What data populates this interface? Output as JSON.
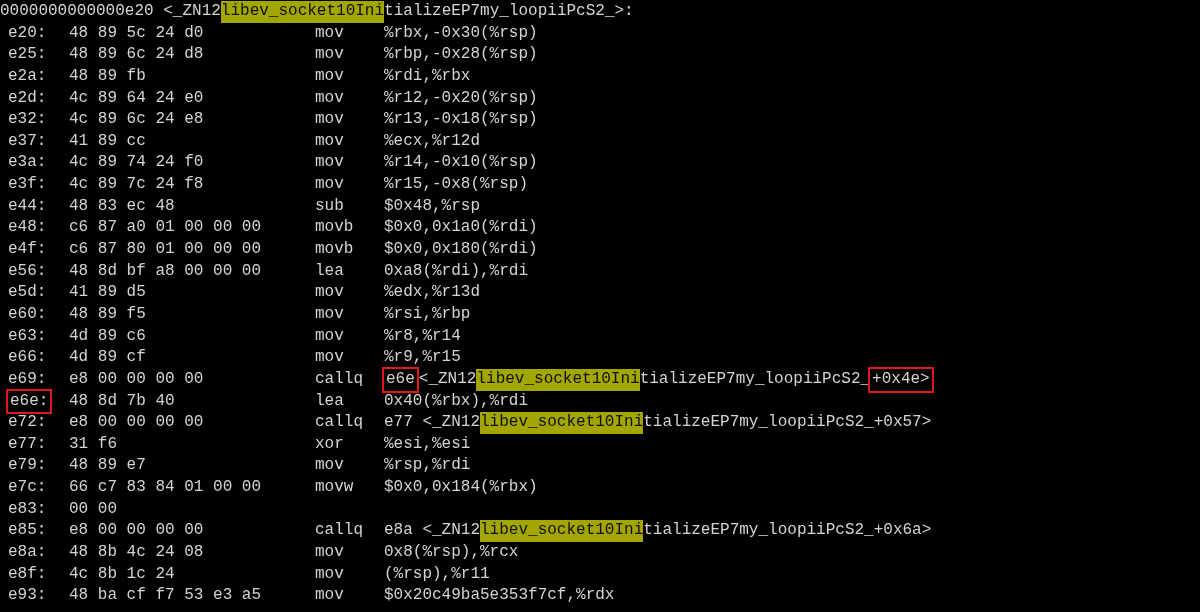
{
  "header": [
    {
      "text": "0000000000000e20 <_ZN12",
      "kind": "plain"
    },
    {
      "text": "libev_socket10Ini",
      "kind": "match"
    },
    {
      "text": "tializeEP7my_loopiiPcS2_>:",
      "kind": "plain"
    }
  ],
  "rows": [
    {
      "address": "e20:",
      "boxed": false,
      "bytes": "48 89 5c 24 d0",
      "mnemonic": "mov",
      "operand": [
        {
          "text": "%rbx,-0x30(%rsp)",
          "kind": "plain"
        }
      ]
    },
    {
      "address": "e25:",
      "boxed": false,
      "bytes": "48 89 6c 24 d8",
      "mnemonic": "mov",
      "operand": [
        {
          "text": "%rbp,-0x28(%rsp)",
          "kind": "plain"
        }
      ]
    },
    {
      "address": "e2a:",
      "boxed": false,
      "bytes": "48 89 fb",
      "mnemonic": "mov",
      "operand": [
        {
          "text": "%rdi,%rbx",
          "kind": "plain"
        }
      ]
    },
    {
      "address": "e2d:",
      "boxed": false,
      "bytes": "4c 89 64 24 e0",
      "mnemonic": "mov",
      "operand": [
        {
          "text": "%r12,-0x20(%rsp)",
          "kind": "plain"
        }
      ]
    },
    {
      "address": "e32:",
      "boxed": false,
      "bytes": "4c 89 6c 24 e8",
      "mnemonic": "mov",
      "operand": [
        {
          "text": "%r13,-0x18(%rsp)",
          "kind": "plain"
        }
      ]
    },
    {
      "address": "e37:",
      "boxed": false,
      "bytes": "41 89 cc",
      "mnemonic": "mov",
      "operand": [
        {
          "text": "%ecx,%r12d",
          "kind": "plain"
        }
      ]
    },
    {
      "address": "e3a:",
      "boxed": false,
      "bytes": "4c 89 74 24 f0",
      "mnemonic": "mov",
      "operand": [
        {
          "text": "%r14,-0x10(%rsp)",
          "kind": "plain"
        }
      ]
    },
    {
      "address": "e3f:",
      "boxed": false,
      "bytes": "4c 89 7c 24 f8",
      "mnemonic": "mov",
      "operand": [
        {
          "text": "%r15,-0x8(%rsp)",
          "kind": "plain"
        }
      ]
    },
    {
      "address": "e44:",
      "boxed": false,
      "bytes": "48 83 ec 48",
      "mnemonic": "sub",
      "operand": [
        {
          "text": "$0x48,%rsp",
          "kind": "plain"
        }
      ]
    },
    {
      "address": "e48:",
      "boxed": false,
      "bytes": "c6 87 a0 01 00 00 00",
      "mnemonic": "movb",
      "operand": [
        {
          "text": "$0x0,0x1a0(%rdi)",
          "kind": "plain"
        }
      ]
    },
    {
      "address": "e4f:",
      "boxed": false,
      "bytes": "c6 87 80 01 00 00 00",
      "mnemonic": "movb",
      "operand": [
        {
          "text": "$0x0,0x180(%rdi)",
          "kind": "plain"
        }
      ]
    },
    {
      "address": "e56:",
      "boxed": false,
      "bytes": "48 8d bf a8 00 00 00",
      "mnemonic": "lea",
      "operand": [
        {
          "text": "0xa8(%rdi),%rdi",
          "kind": "plain"
        }
      ]
    },
    {
      "address": "e5d:",
      "boxed": false,
      "bytes": "41 89 d5",
      "mnemonic": "mov",
      "operand": [
        {
          "text": "%edx,%r13d",
          "kind": "plain"
        }
      ]
    },
    {
      "address": "e60:",
      "boxed": false,
      "bytes": "48 89 f5",
      "mnemonic": "mov",
      "operand": [
        {
          "text": "%rsi,%rbp",
          "kind": "plain"
        }
      ]
    },
    {
      "address": "e63:",
      "boxed": false,
      "bytes": "4d 89 c6",
      "mnemonic": "mov",
      "operand": [
        {
          "text": "%r8,%r14",
          "kind": "plain"
        }
      ]
    },
    {
      "address": "e66:",
      "boxed": false,
      "bytes": "4d 89 cf",
      "mnemonic": "mov",
      "operand": [
        {
          "text": "%r9,%r15",
          "kind": "plain"
        }
      ]
    },
    {
      "address": "e69:",
      "boxed": false,
      "bytes": "e8 00 00 00 00",
      "mnemonic": "callq",
      "operand": [
        {
          "text": "e6e",
          "kind": "boxed"
        },
        {
          "text": "<_ZN12",
          "kind": "plain"
        },
        {
          "text": "libev_socket10Ini",
          "kind": "match"
        },
        {
          "text": "tializeEP7my_loopiiPcS2_",
          "kind": "plain"
        },
        {
          "text": "+0x4e>",
          "kind": "boxed"
        }
      ]
    },
    {
      "address": "e6e:",
      "boxed": true,
      "bytes": "48 8d 7b 40",
      "mnemonic": "lea",
      "operand": [
        {
          "text": "0x40(%rbx),%rdi",
          "kind": "plain"
        }
      ]
    },
    {
      "address": "e72:",
      "boxed": false,
      "bytes": "e8 00 00 00 00",
      "mnemonic": "callq",
      "operand": [
        {
          "text": "e77 <_ZN12",
          "kind": "plain"
        },
        {
          "text": "libev_socket10Ini",
          "kind": "match"
        },
        {
          "text": "tializeEP7my_loopiiPcS2_+0x57>",
          "kind": "plain"
        }
      ]
    },
    {
      "address": "e77:",
      "boxed": false,
      "bytes": "31 f6",
      "mnemonic": "xor",
      "operand": [
        {
          "text": "%esi,%esi",
          "kind": "plain"
        }
      ]
    },
    {
      "address": "e79:",
      "boxed": false,
      "bytes": "48 89 e7",
      "mnemonic": "mov",
      "operand": [
        {
          "text": "%rsp,%rdi",
          "kind": "plain"
        }
      ]
    },
    {
      "address": "e7c:",
      "boxed": false,
      "bytes": "66 c7 83 84 01 00 00",
      "mnemonic": "movw",
      "operand": [
        {
          "text": "$0x0,0x184(%rbx)",
          "kind": "plain"
        }
      ]
    },
    {
      "address": "e83:",
      "boxed": false,
      "bytes": "00 00",
      "operand": []
    },
    {
      "address": "e85:",
      "boxed": false,
      "bytes": "e8 00 00 00 00",
      "mnemonic": "callq",
      "operand": [
        {
          "text": "e8a <_ZN12",
          "kind": "plain"
        },
        {
          "text": "libev_socket10Ini",
          "kind": "match"
        },
        {
          "text": "tializeEP7my_loopiiPcS2_+0x6a>",
          "kind": "plain"
        }
      ]
    },
    {
      "address": "e8a:",
      "boxed": false,
      "bytes": "48 8b 4c 24 08",
      "mnemonic": "mov",
      "operand": [
        {
          "text": "0x8(%rsp),%rcx",
          "kind": "plain"
        }
      ]
    },
    {
      "address": "e8f:",
      "boxed": false,
      "bytes": "4c 8b 1c 24",
      "mnemonic": "mov",
      "operand": [
        {
          "text": "(%rsp),%r11",
          "kind": "plain"
        }
      ]
    },
    {
      "address": "e93:",
      "boxed": false,
      "bytes": "48 ba cf f7 53 e3 a5",
      "mnemonic": "mov",
      "operand": [
        {
          "text": "$0x20c49ba5e353f7cf,%rdx",
          "kind": "plain"
        }
      ]
    }
  ]
}
